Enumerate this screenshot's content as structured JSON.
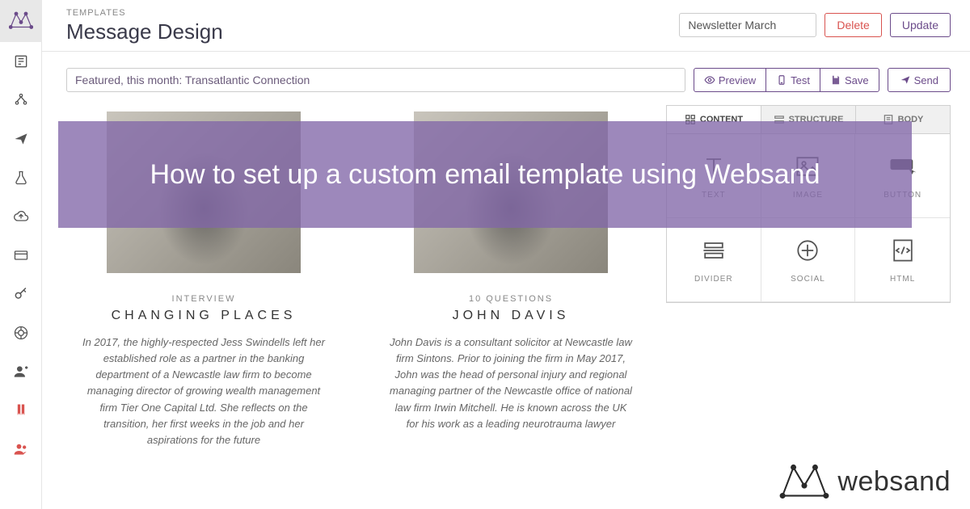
{
  "header": {
    "crumb": "TEMPLATES",
    "title": "Message Design",
    "template_name": "Newsletter March",
    "delete_label": "Delete",
    "update_label": "Update"
  },
  "toolbar": {
    "subject": "Featured, this month: Transatlantic Connection",
    "preview_label": "Preview",
    "test_label": "Test",
    "save_label": "Save",
    "send_label": "Send"
  },
  "panel": {
    "tabs": {
      "content": "CONTENT",
      "structure": "STRUCTURE",
      "body": "BODY"
    },
    "tiles": {
      "text": "TEXT",
      "image": "IMAGE",
      "button": "BUTTON",
      "divider": "DIVIDER",
      "social": "SOCIAL",
      "html": "HTML"
    }
  },
  "articles": [
    {
      "eyebrow": "INTERVIEW",
      "title": "CHANGING PLACES",
      "body": "In 2017, the highly-respected Jess Swindells left her established role as a partner in the banking department of a Newcastle law firm to become managing director of growing wealth management firm Tier One Capital Ltd. She reflects on the transition, her first weeks in the job and her aspirations for the future"
    },
    {
      "eyebrow": "10 QUESTIONS",
      "title": "JOHN DAVIS",
      "body": "John Davis is a consultant solicitor at Newcastle law firm Sintons. Prior to joining the firm in May 2017, John was the head of personal injury and regional managing partner of the Newcastle office of national law firm Irwin Mitchell. He is known across the UK for his work as a leading neurotrauma lawyer"
    }
  ],
  "overlay": {
    "text": "How to set up a custom email template using Websand"
  },
  "brand": {
    "name": "websand"
  },
  "colors": {
    "purple": "#6b4b8a",
    "red": "#d9534f"
  }
}
